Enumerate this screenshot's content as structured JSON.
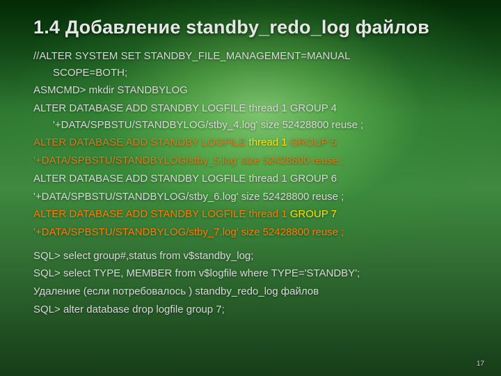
{
  "title": "1.4 Добавление standby_redo_log файлов",
  "l1a": "//ALTER SYSTEM SET STANDBY_FILE_MANAGEMENT=MANUAL",
  "l1b": "SCOPE=BOTH;",
  "l2": "ASMCMD>   mkdir  STANDBYLOG",
  "l3a": "ALTER DATABASE ADD STANDBY LOGFILE  thread 1 GROUP   4",
  "l3b": "'+DATA/SPBSTU/STANDBYLOG/stby_4.log' size 52428800 reuse ;",
  "l4a_pre": "ALTER DATABASE ADD STANDBY LOGFILE ",
  "l4a_mid": "thread 1",
  "l4a_suf": " GROUP  5",
  "l4b": "'+DATA/SPBSTU/STANDBYLOG/stby_5.log' size 52428800 reuse ;",
  "l5a": "ALTER DATABASE ADD STANDBY LOGFILE thread 1  GROUP  6",
  "l5b": "'+DATA/SPBSTU/STANDBYLOG/stby_6.log' size 52428800 reuse ;",
  "l6a_pre": "ALTER DATABASE ADD STANDBY LOGFILE  ",
  "l6a_mid": "thread 1 ",
  "l6a_grp": "GROUP  7",
  "l6b": "'+DATA/SPBSTU/STANDBYLOG/stby_7.log' size 52428800 reuse ;",
  "l7": "SQL> select group#,status from v$standby_log;",
  "l8": "SQL> select TYPE, MEMBER from v$logfile where TYPE='STANDBY';",
  "l9": "Удаление (если потребовалось ) standby_redo_log файлов",
  "l10": "SQL> alter database drop logfile group 7;",
  "pagenum": "17"
}
